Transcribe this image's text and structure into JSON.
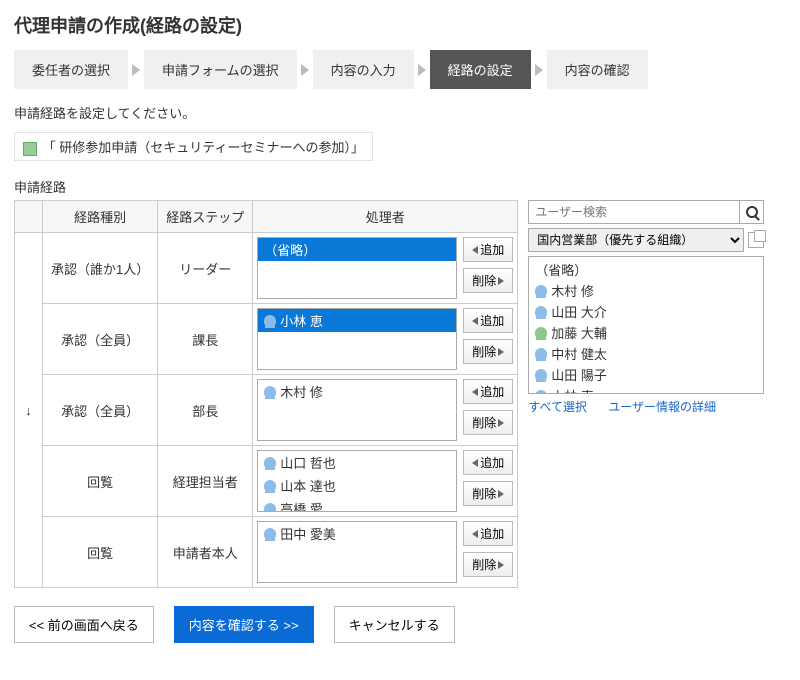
{
  "title": "代理申請の作成(経路の設定)",
  "steps": [
    "委任者の選択",
    "申請フォームの選択",
    "内容の入力",
    "経路の設定",
    "内容の確認"
  ],
  "active_step": 3,
  "instruction": "申請経路を設定してください。",
  "form_name": "「 研修参加申請（セキュリティーセミナーへの参加）」",
  "section_label": "申請経路",
  "headers": {
    "type": "経路種別",
    "step": "経路ステップ",
    "proc": "処理者"
  },
  "buttons": {
    "add": "追加",
    "remove": "削除",
    "back": "<< 前の画面へ戻る",
    "confirm": "内容を確認する >>",
    "cancel": "キャンセルする"
  },
  "rows": [
    {
      "type": "承認（誰か1人）",
      "step": "リーダー",
      "items": [
        {
          "label": "（省略）",
          "sel": true
        }
      ]
    },
    {
      "type": "承認（全員）",
      "step": "課長",
      "items": [
        {
          "label": "小林 恵",
          "sel": true,
          "icon": true
        }
      ]
    },
    {
      "type": "承認（全員）",
      "step": "部長",
      "items": [
        {
          "label": "木村 修",
          "icon": true
        }
      ]
    },
    {
      "type": "回覧",
      "step": "経理担当者",
      "items": [
        {
          "label": "山口 哲也",
          "icon": true
        },
        {
          "label": "山本 達也",
          "icon": true
        },
        {
          "label": "高橋 愛",
          "icon": true
        }
      ]
    },
    {
      "type": "回覧",
      "step": "申請者本人",
      "items": [
        {
          "label": "田中 愛美",
          "icon": true
        }
      ]
    }
  ],
  "picker": {
    "search_placeholder": "ユーザー検索",
    "org_selected": "国内営業部（優先する組織）",
    "users": [
      {
        "label": "（省略）"
      },
      {
        "label": "木村 修",
        "icon": true
      },
      {
        "label": "山田 大介",
        "icon": true
      },
      {
        "label": "加藤 大輔",
        "icon": true,
        "green": true
      },
      {
        "label": "中村 健太",
        "icon": true
      },
      {
        "label": "山田 陽子",
        "icon": true
      },
      {
        "label": "小林 恵",
        "icon": true
      }
    ],
    "select_all": "すべて選択",
    "user_detail": "ユーザー情報の詳細"
  }
}
